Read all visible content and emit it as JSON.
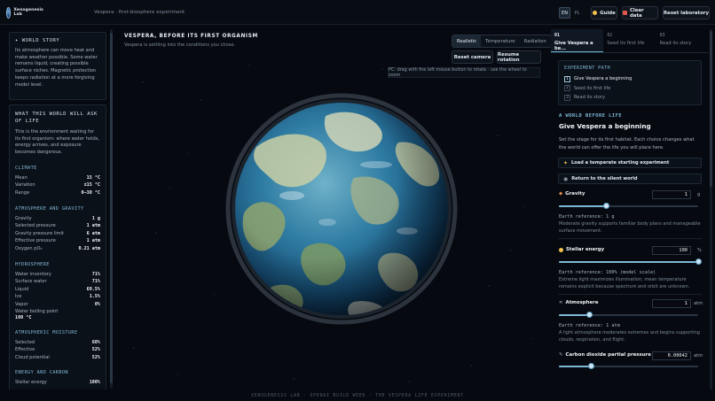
{
  "header": {
    "logo_text": "Xenogenesis Lab",
    "subtitle": "Vespera · first-biosphere experiment",
    "lang_en": "EN",
    "lang_pl": "PL",
    "guide": "Guide",
    "clear": "Clear data",
    "reset": "Reset laboratory",
    "colors": {
      "guide_dot": "#f2c14e",
      "clear_dot": "#e2574c"
    }
  },
  "left": {
    "world_story": {
      "title": "✦ WORLD STORY",
      "text": "Its atmosphere can move heat and make weather possible. Some water remains liquid, creating possible surface niches. Magnetic protection keeps radiation at a more forgiving model level."
    },
    "ask": {
      "title": "WHAT THIS WORLD WILL ASK OF LIFE",
      "text": "This is the environment waiting for its first organism: where water holds, energy arrives, and exposure becomes dangerous."
    },
    "climate": {
      "title": "CLIMATE",
      "rows": [
        {
          "label": "Mean",
          "value": "15 °C"
        },
        {
          "label": "Variation",
          "value": "±15 °C"
        },
        {
          "label": "Range",
          "value": "0–30 °C"
        }
      ]
    },
    "atmosphere": {
      "title": "ATMOSPHERE AND GRAVITY",
      "rows": [
        {
          "label": "Gravity",
          "value": "1 g"
        },
        {
          "label": "Selected pressure",
          "value": "1 atm"
        },
        {
          "label": "Gravity pressure limit",
          "value": "6 atm"
        },
        {
          "label": "Effective pressure",
          "value": "1 atm"
        },
        {
          "label": "Oxygen pO₂",
          "value": "0.21 atm"
        }
      ]
    },
    "hydro": {
      "title": "HYDROSPHERE",
      "rows": [
        {
          "label": "Water inventory",
          "value": "71%"
        },
        {
          "label": "Surface water",
          "value": "71%"
        },
        {
          "label": "Liquid",
          "value": "69.5%"
        },
        {
          "label": "Ice",
          "value": "1.5%"
        },
        {
          "label": "Vapor",
          "value": "0%"
        }
      ],
      "boiling_label": "Water boiling point",
      "boiling_value": "100 °C"
    },
    "moisture": {
      "title": "ATMOSPHERIC MOISTURE",
      "rows": [
        {
          "label": "Selected",
          "value": "60%"
        },
        {
          "label": "Effective",
          "value": "52%"
        },
        {
          "label": "Cloud potential",
          "value": "52%"
        }
      ]
    },
    "energy": {
      "title": "ENERGY AND CARBON",
      "rows": [
        {
          "label": "Stellar energy",
          "value": "100%"
        }
      ]
    }
  },
  "stage": {
    "title": "VESPERA, BEFORE ITS FIRST ORGANISM",
    "subtitle": "Vespera is settling into the conditions you chose.",
    "modes": [
      "Realistic",
      "Temperature",
      "Radiation"
    ],
    "reset_camera": "Reset camera",
    "resume_rotation": "Resume rotation",
    "hint": "PC: drag with the left mouse button to rotate · use the wheel to zoom"
  },
  "right": {
    "tabs": [
      {
        "n": "01",
        "label": "Give Vespera a be..."
      },
      {
        "n": "02",
        "label": "Seed its first life"
      },
      {
        "n": "03",
        "label": "Read its story"
      }
    ],
    "path": {
      "title": "EXPERIMENT PATH",
      "steps": [
        "Give Vespera a beginning",
        "Seed its first life",
        "Read its story"
      ]
    },
    "kicker": "A WORLD BEFORE LIFE",
    "heading": "Give Vespera a beginning",
    "description": "Set the stage for its first habitat. Each choice changes what the world can offer the life you will place here.",
    "load_btn": "Load a temperate starting experiment",
    "silent_btn": "Return to the silent world",
    "params": {
      "gravity": {
        "label": "Gravity",
        "value": "1",
        "unit": "g",
        "level": 0.34,
        "earth": "Earth reference: 1 g",
        "note": "Moderate gravity supports familiar body plans and manageable surface movement."
      },
      "stellar": {
        "label": "Stellar energy",
        "value": "100",
        "unit": "%",
        "level": 1.0,
        "earth": "Earth reference: 100% (model scale)",
        "note": "Extreme light maximizes illumination; mean temperature remains explicit because spectrum and orbit are unknown."
      },
      "atmo": {
        "label": "Atmosphere",
        "value": "1",
        "unit": "atm",
        "level": 0.22,
        "earth": "Earth reference: 1 atm",
        "note": "A light atmosphere moderates extremes and begins supporting clouds, respiration, and flight."
      },
      "co2": {
        "label": "Carbon dioxide partial pressure",
        "value": "0.00042",
        "unit": "atm",
        "level": 0.23
      }
    }
  },
  "footer": "XENOGENESIS LAB · OPENAI BUILD WEEK · THE VESPERA LIFE EXPERIMENT"
}
